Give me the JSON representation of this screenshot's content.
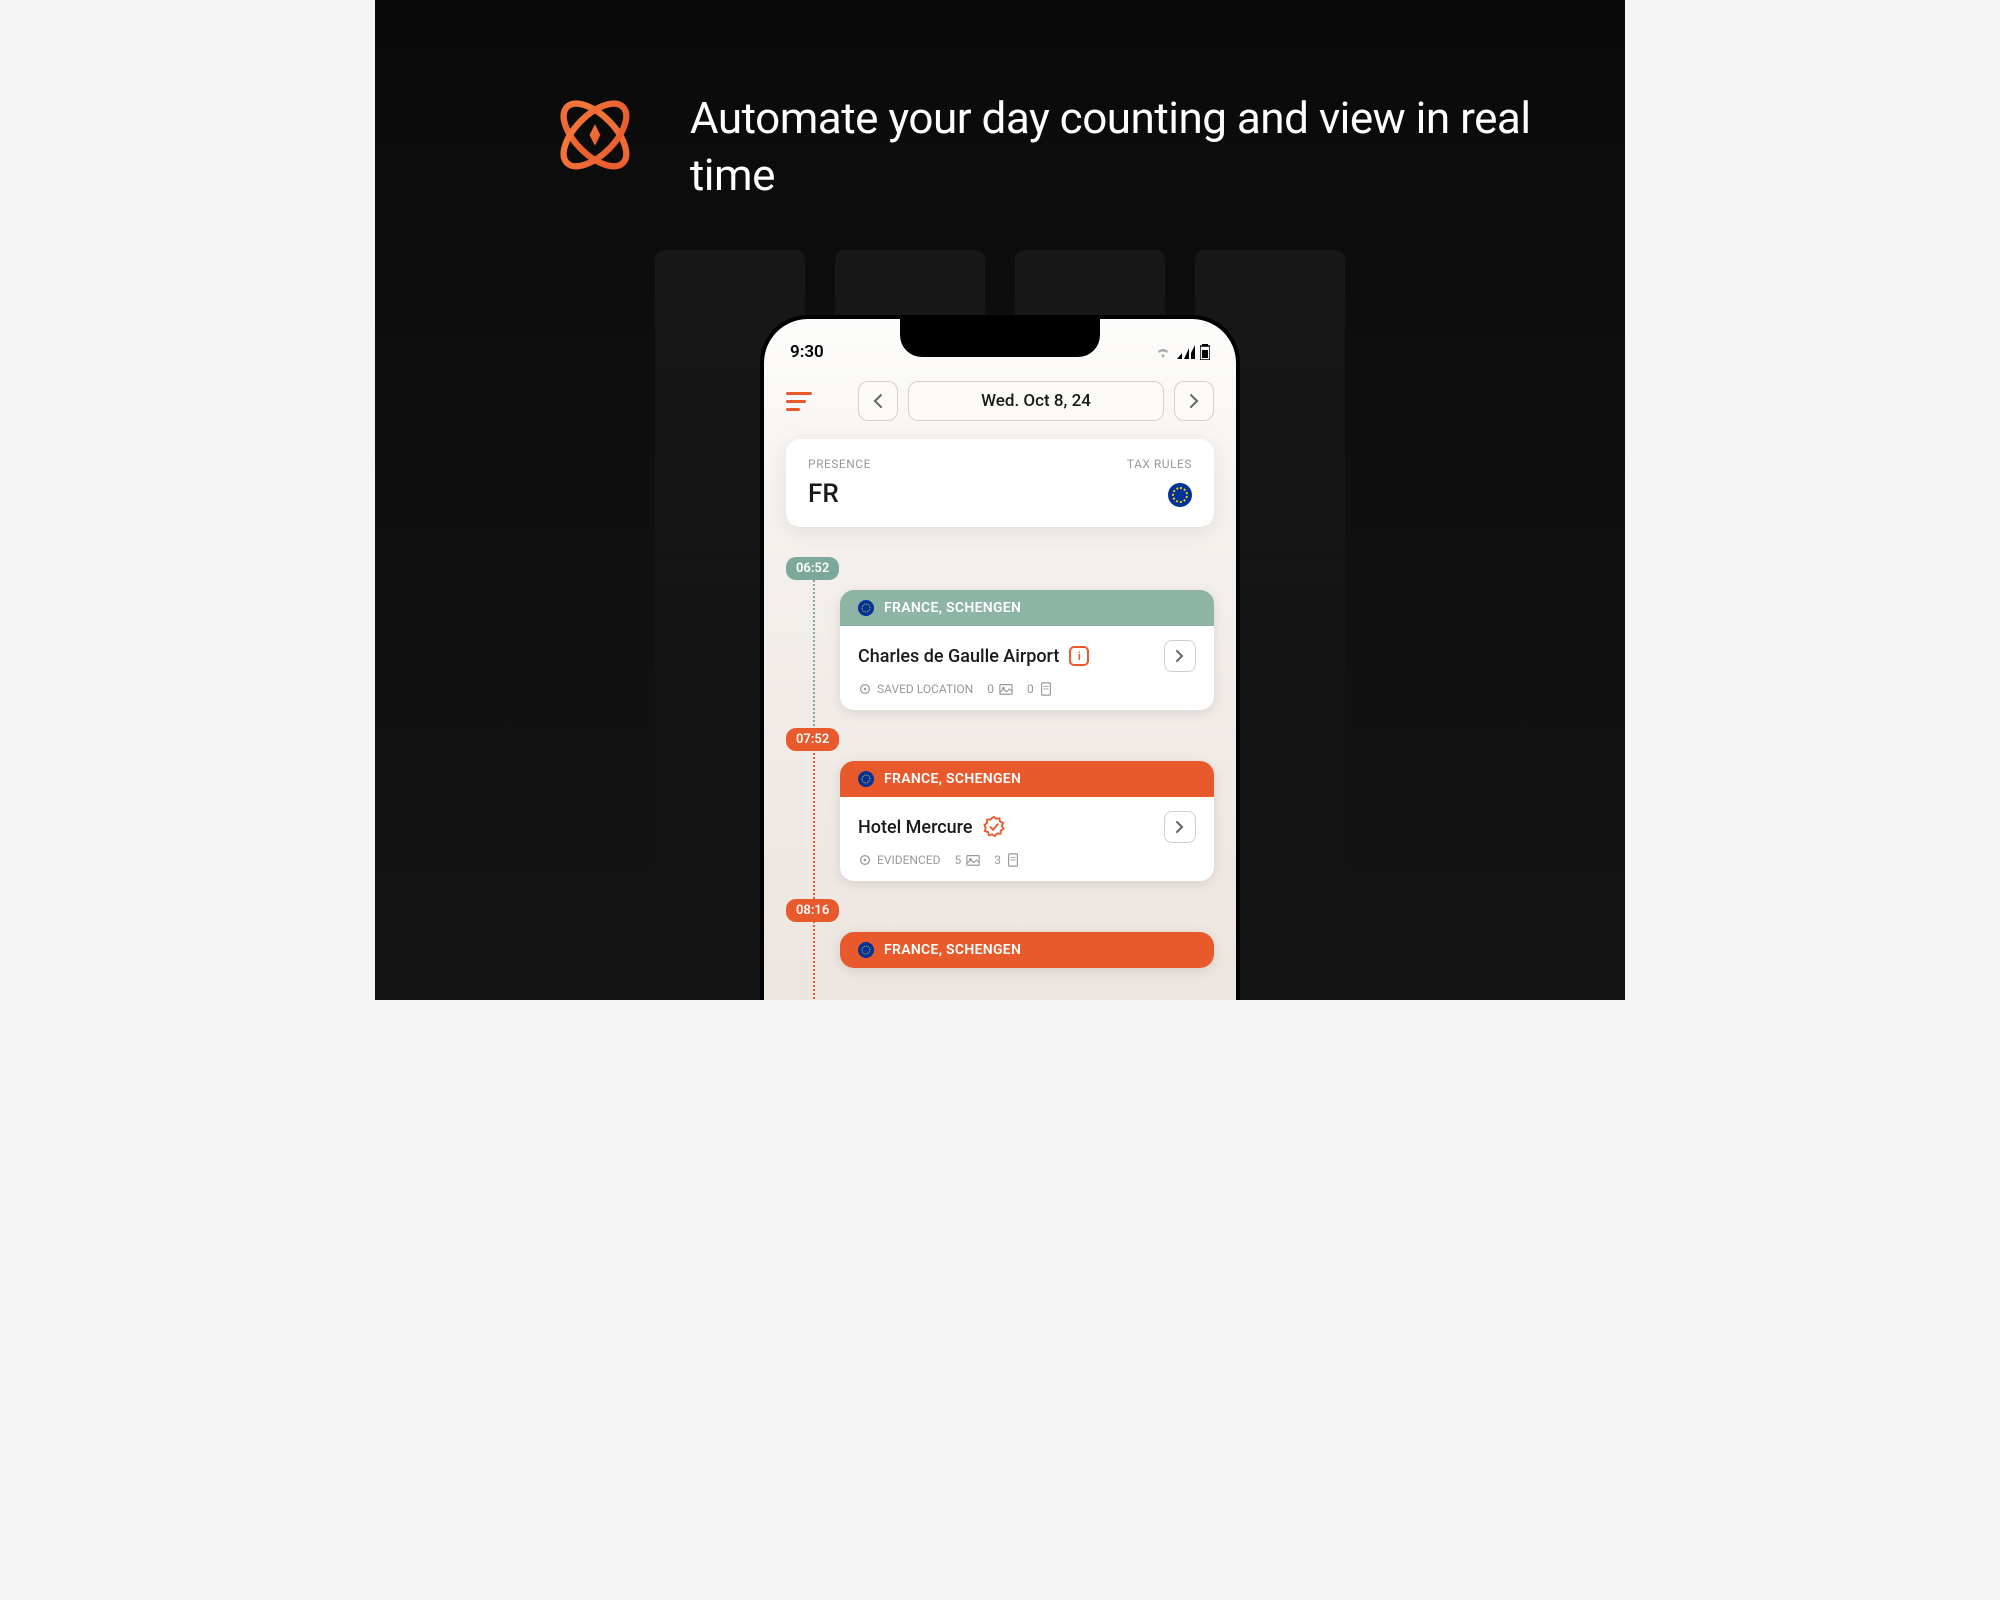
{
  "headline": "Automate your day counting and view in real time",
  "status": {
    "time": "9:30"
  },
  "nav": {
    "date": "Wed. Oct 8, 24"
  },
  "presence_card": {
    "presence_label": "PRESENCE",
    "presence_value": "FR",
    "tax_label": "TAX RULES"
  },
  "timeline": {
    "events": [
      {
        "time": "06:52",
        "color": "green",
        "region": "FRANCE, SCHENGEN",
        "title": "Charles de Gaulle Airport",
        "meta_label": "SAVED LOCATION",
        "count_photos": "0",
        "count_docs": "0",
        "icon_type": "info"
      },
      {
        "time": "07:52",
        "color": "orange",
        "region": "FRANCE, SCHENGEN",
        "title": "Hotel Mercure",
        "meta_label": "EVIDENCED",
        "count_photos": "5",
        "count_docs": "3",
        "icon_type": "badge"
      },
      {
        "time": "08:16",
        "color": "orange",
        "region": "FRANCE, SCHENGEN",
        "title": "",
        "meta_label": "",
        "count_photos": "",
        "count_docs": "",
        "icon_type": ""
      }
    ]
  }
}
